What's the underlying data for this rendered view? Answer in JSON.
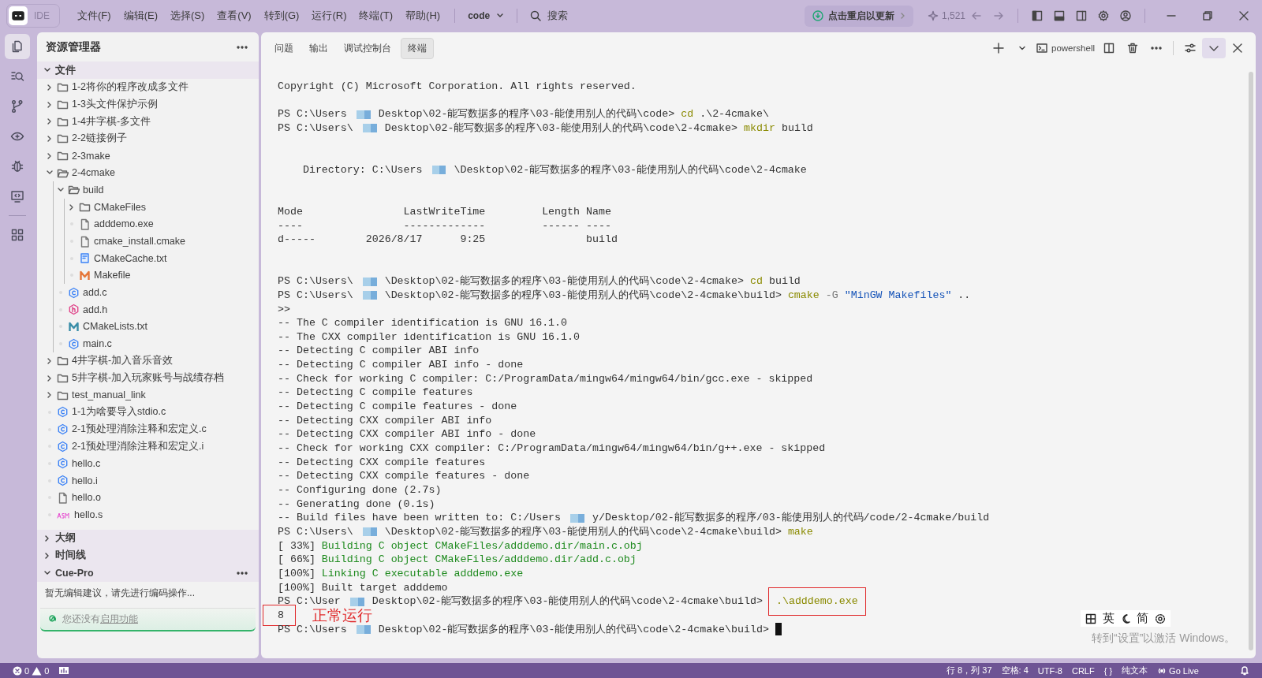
{
  "titlebar": {
    "app": "IDE",
    "menus": [
      "文件(F)",
      "编辑(E)",
      "选择(S)",
      "查看(V)",
      "转到(G)",
      "运行(R)",
      "终端(T)",
      "帮助(H)"
    ],
    "workspace": "code",
    "search": "搜索",
    "update": "点击重启以更新",
    "stars": "1,521"
  },
  "activity_bar": [
    {
      "kind": "explorer",
      "selected": true
    },
    {
      "kind": "search",
      "selected": false
    },
    {
      "kind": "source-control",
      "selected": false
    },
    {
      "kind": "preview",
      "selected": false
    },
    {
      "kind": "debug",
      "selected": false
    },
    {
      "kind": "remote",
      "selected": false
    },
    {
      "kind": "extensions",
      "selected": false
    }
  ],
  "explorer": {
    "title": "资源管理器",
    "sections": [
      {
        "title": "文件",
        "expanded": true,
        "tree": [
          {
            "name": "1-2将你的程序改成多文件",
            "kind": "folder",
            "expanded": false
          },
          {
            "name": "1-3头文件保护示例",
            "kind": "folder",
            "expanded": false
          },
          {
            "name": "1-4井字棋-多文件",
            "kind": "folder",
            "expanded": false
          },
          {
            "name": "2-2链接例子",
            "kind": "folder",
            "expanded": false
          },
          {
            "name": "2-3make",
            "kind": "folder",
            "expanded": false
          },
          {
            "name": "2-4cmake",
            "kind": "folder",
            "expanded": true,
            "children": [
              {
                "name": "build",
                "kind": "folder",
                "expanded": true,
                "children": [
                  {
                    "name": "CMakeFiles",
                    "kind": "folder",
                    "expanded": false
                  },
                  {
                    "name": "adddemo.exe",
                    "kind": "file"
                  },
                  {
                    "name": "cmake_install.cmake",
                    "kind": "file"
                  },
                  {
                    "name": "CMakeCache.txt",
                    "kind": "txt"
                  },
                  {
                    "name": "Makefile",
                    "kind": "makefile"
                  }
                ]
              },
              {
                "name": "add.c",
                "kind": "c"
              },
              {
                "name": "add.h",
                "kind": "h"
              },
              {
                "name": "CMakeLists.txt",
                "kind": "cmake"
              },
              {
                "name": "main.c",
                "kind": "c"
              }
            ]
          },
          {
            "name": "4井字棋-加入音乐音效",
            "kind": "folder",
            "expanded": false
          },
          {
            "name": "5井字棋-加入玩家账号与战绩存档",
            "kind": "folder",
            "expanded": false
          },
          {
            "name": "test_manual_link",
            "kind": "folder",
            "expanded": false
          },
          {
            "name": "1-1为啥要导入stdio.c",
            "kind": "c"
          },
          {
            "name": "2-1预处理消除注释和宏定义.c",
            "kind": "c"
          },
          {
            "name": "2-1预处理消除注释和宏定义.i",
            "kind": "c"
          },
          {
            "name": "hello.c",
            "kind": "c"
          },
          {
            "name": "hello.i",
            "kind": "c"
          },
          {
            "name": "hello.o",
            "kind": "file"
          },
          {
            "name": "hello.s",
            "kind": "asm"
          }
        ]
      },
      {
        "title": "大纲",
        "expanded": false
      },
      {
        "title": "时间线",
        "expanded": false
      },
      {
        "title": "Cue-Pro",
        "expanded": true,
        "message": "暂无编辑建议，请先进行编码操作...",
        "notice": {
          "text": "您还没有",
          "link": "启用功能"
        }
      }
    ]
  },
  "terminal": {
    "tabs": [
      {
        "label": "问题",
        "selected": false
      },
      {
        "label": "输出",
        "selected": false
      },
      {
        "label": "调试控制台",
        "selected": false
      },
      {
        "label": "终端",
        "selected": true
      }
    ],
    "shell": "powershell",
    "lines": [
      {
        "kind": "output",
        "segments": [
          {
            "kind": "plain",
            "text": "Copyright (C) Microsoft Corporation. All rights reserved."
          }
        ]
      },
      {
        "kind": "blank"
      },
      {
        "kind": "output",
        "segments": [
          {
            "kind": "plain",
            "text": "PS C:\\Users"
          },
          {
            "kind": "redacted"
          },
          {
            "kind": "plain",
            "text": "Desktop\\02-能写数据多的程序\\03-能使用别人的代码\\code> "
          },
          {
            "kind": "command",
            "text": "cd"
          },
          {
            "kind": "plain",
            "text": " .\\2-4cmake\\"
          }
        ]
      },
      {
        "kind": "output",
        "segments": [
          {
            "kind": "plain",
            "text": "PS C:\\Users\\"
          },
          {
            "kind": "redacted"
          },
          {
            "kind": "plain",
            "text": "Desktop\\02-能写数据多的程序\\03-能使用别人的代码\\code\\2-4cmake> "
          },
          {
            "kind": "command",
            "text": "mkdir"
          },
          {
            "kind": "plain",
            "text": " build"
          }
        ]
      },
      {
        "kind": "blank"
      },
      {
        "kind": "blank"
      },
      {
        "kind": "output",
        "segments": [
          {
            "kind": "plain",
            "text": "    Directory: C:\\Users"
          },
          {
            "kind": "redacted"
          },
          {
            "kind": "plain",
            "text": "\\Desktop\\02-能写数据多的程序\\03-能使用别人的代码\\code\\2-4cmake"
          }
        ]
      },
      {
        "kind": "blank"
      },
      {
        "kind": "blank"
      },
      {
        "kind": "output",
        "segments": [
          {
            "kind": "plain",
            "text": "Mode                LastWriteTime         Length Name"
          }
        ]
      },
      {
        "kind": "output",
        "segments": [
          {
            "kind": "plain",
            "text": "----                -------------         ------ ----"
          }
        ]
      },
      {
        "kind": "output",
        "segments": [
          {
            "kind": "plain",
            "text": "d-----        2026/8/17      9:25                build"
          }
        ]
      },
      {
        "kind": "blank"
      },
      {
        "kind": "blank"
      },
      {
        "kind": "output",
        "segments": [
          {
            "kind": "plain",
            "text": "PS C:\\Users\\"
          },
          {
            "kind": "redacted"
          },
          {
            "kind": "plain",
            "text": "\\Desktop\\02-能写数据多的程序\\03-能使用别人的代码\\code\\2-4cmake> "
          },
          {
            "kind": "command",
            "text": "cd"
          },
          {
            "kind": "plain",
            "text": " build"
          }
        ]
      },
      {
        "kind": "output",
        "segments": [
          {
            "kind": "plain",
            "text": "PS C:\\Users\\"
          },
          {
            "kind": "redacted"
          },
          {
            "kind": "plain",
            "text": "\\Desktop\\02-能写数据多的程序\\03-能使用别人的代码\\code\\2-4cmake\\build> "
          },
          {
            "kind": "command",
            "text": "cmake"
          },
          {
            "kind": "flag",
            "text": " -G"
          },
          {
            "kind": "string",
            "text": " \"MinGW Makefiles\""
          },
          {
            "kind": "plain",
            "text": " .."
          }
        ]
      },
      {
        "kind": "output",
        "segments": [
          {
            "kind": "plain",
            "text": ">>"
          }
        ]
      },
      {
        "kind": "output",
        "segments": [
          {
            "kind": "plain",
            "text": "-- The C compiler identification is GNU 16.1.0"
          }
        ]
      },
      {
        "kind": "output",
        "segments": [
          {
            "kind": "plain",
            "text": "-- The CXX compiler identification is GNU 16.1.0"
          }
        ]
      },
      {
        "kind": "output",
        "segments": [
          {
            "kind": "plain",
            "text": "-- Detecting C compiler ABI info"
          }
        ]
      },
      {
        "kind": "output",
        "segments": [
          {
            "kind": "plain",
            "text": "-- Detecting C compiler ABI info - done"
          }
        ]
      },
      {
        "kind": "output",
        "segments": [
          {
            "kind": "plain",
            "text": "-- Check for working C compiler: C:/ProgramData/mingw64/mingw64/bin/gcc.exe - skipped"
          }
        ]
      },
      {
        "kind": "output",
        "segments": [
          {
            "kind": "plain",
            "text": "-- Detecting C compile features"
          }
        ]
      },
      {
        "kind": "output",
        "segments": [
          {
            "kind": "plain",
            "text": "-- Detecting C compile features - done"
          }
        ]
      },
      {
        "kind": "output",
        "segments": [
          {
            "kind": "plain",
            "text": "-- Detecting CXX compiler ABI info"
          }
        ]
      },
      {
        "kind": "output",
        "segments": [
          {
            "kind": "plain",
            "text": "-- Detecting CXX compiler ABI info - done"
          }
        ]
      },
      {
        "kind": "output",
        "segments": [
          {
            "kind": "plain",
            "text": "-- Check for working CXX compiler: C:/ProgramData/mingw64/mingw64/bin/g++.exe - skipped"
          }
        ]
      },
      {
        "kind": "output",
        "segments": [
          {
            "kind": "plain",
            "text": "-- Detecting CXX compile features"
          }
        ]
      },
      {
        "kind": "output",
        "segments": [
          {
            "kind": "plain",
            "text": "-- Detecting CXX compile features - done"
          }
        ]
      },
      {
        "kind": "output",
        "segments": [
          {
            "kind": "plain",
            "text": "-- Configuring done (2.7s)"
          }
        ]
      },
      {
        "kind": "output",
        "segments": [
          {
            "kind": "plain",
            "text": "-- Generating done (0.1s)"
          }
        ]
      },
      {
        "kind": "output",
        "segments": [
          {
            "kind": "plain",
            "text": "-- Build files have been written to: C:/Users"
          },
          {
            "kind": "redacted"
          },
          {
            "kind": "plain",
            "text": "y/Desktop/02-能写数据多的程序/03-能使用别人的代码/code/2-4cmake/build"
          }
        ]
      },
      {
        "kind": "output",
        "segments": [
          {
            "kind": "plain",
            "text": "PS C:\\Users\\"
          },
          {
            "kind": "redacted"
          },
          {
            "kind": "plain",
            "text": "\\Desktop\\02-能写数据多的程序\\03-能使用别人的代码\\code\\2-4cmake\\build> "
          },
          {
            "kind": "command",
            "text": "make"
          }
        ]
      },
      {
        "kind": "output",
        "segments": [
          {
            "kind": "plain",
            "text": "[ 33%] "
          },
          {
            "kind": "success",
            "text": "Building C object CMakeFiles/adddemo.dir/main.c.obj"
          }
        ]
      },
      {
        "kind": "output",
        "segments": [
          {
            "kind": "plain",
            "text": "[ 66%] "
          },
          {
            "kind": "success",
            "text": "Building C object CMakeFiles/adddemo.dir/add.c.obj"
          }
        ]
      },
      {
        "kind": "output",
        "segments": [
          {
            "kind": "plain",
            "text": "[100%] "
          },
          {
            "kind": "success",
            "text": "Linking C executable adddemo.exe"
          }
        ]
      },
      {
        "kind": "output",
        "segments": [
          {
            "kind": "plain",
            "text": "[100%] Built target adddemo"
          }
        ]
      },
      {
        "kind": "output",
        "segments": [
          {
            "kind": "plain",
            "text": "PS C:\\User"
          },
          {
            "kind": "redacted"
          },
          {
            "kind": "plain",
            "text": "Desktop\\02-能写数据多的程序\\03-能使用别人的代码\\code\\2-4cmake\\build> "
          },
          {
            "kind": "boxed-command",
            "text": ".\\adddemo.exe"
          }
        ]
      },
      {
        "kind": "output",
        "segments": [
          {
            "kind": "boxed",
            "text": "8"
          },
          {
            "kind": "note",
            "text": "正常运行"
          }
        ]
      },
      {
        "kind": "output",
        "segments": [
          {
            "kind": "plain",
            "text": "PS C:\\Users"
          },
          {
            "kind": "redacted"
          },
          {
            "kind": "plain",
            "text": "Desktop\\02-能写数据多的程序\\03-能使用别人的代码\\code\\2-4cmake\\build> "
          },
          {
            "kind": "cursor"
          }
        ]
      }
    ]
  },
  "overlay": {
    "ime": [
      "英",
      "简"
    ],
    "activation": "转到“设置”以激活 Windows。"
  },
  "status_bar": {
    "errors": "0",
    "warnings": "0",
    "items": [
      "行 8，列 37",
      "空格: 4",
      "UTF-8",
      "CRLF",
      "{ }",
      "纯文本"
    ],
    "live": "Go Live"
  }
}
